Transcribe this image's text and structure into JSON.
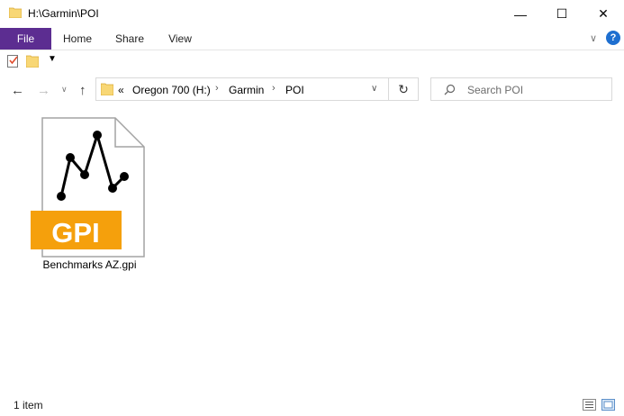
{
  "window": {
    "title": "H:\\Garmin\\POI",
    "minimize": "—",
    "maximize": "☐",
    "close": "✕"
  },
  "ribbon": {
    "tabs": [
      "File",
      "Home",
      "Share",
      "View"
    ],
    "help": "?"
  },
  "address": {
    "overflow": "«",
    "crumbs": [
      "Oregon 700 (H:)",
      "Garmin",
      "POI"
    ]
  },
  "search": {
    "placeholder": "Search POI"
  },
  "files": [
    {
      "name": "Benchmarks AZ.gpi",
      "badge": "GPI"
    }
  ],
  "status": {
    "count": "1 item"
  },
  "colors": {
    "file_tab": "#5c2d91",
    "gpi_badge": "#f5a00c",
    "folder": "#f8d775"
  }
}
